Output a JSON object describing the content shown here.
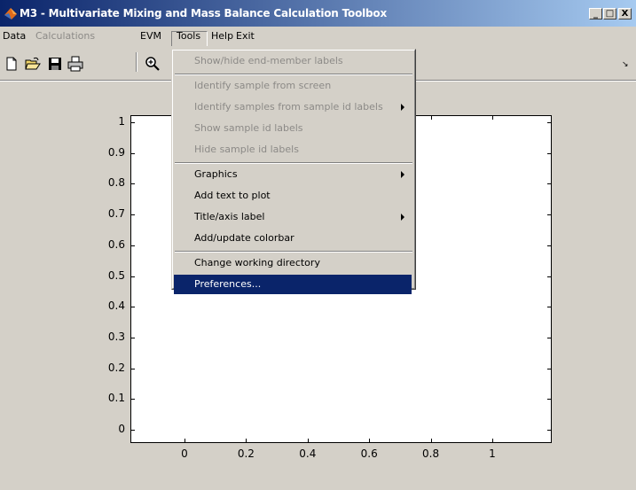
{
  "window": {
    "title": "M3 - Multivariate Mixing and Mass Balance Calculation Toolbox",
    "controls": {
      "minimize": "_",
      "maximize": "□",
      "close": "X"
    }
  },
  "menubar": {
    "items": [
      {
        "label": "Data",
        "enabled": true
      },
      {
        "label": "Calculations",
        "enabled": false
      },
      {
        "label": "EVM",
        "enabled": true
      },
      {
        "label": "Tools",
        "enabled": true,
        "open": true
      },
      {
        "label": "Help",
        "enabled": true
      },
      {
        "label": "Exit",
        "enabled": true
      }
    ],
    "dock_icon": "dock-arrow-icon"
  },
  "toolbar": {
    "buttons": [
      "new-file-icon",
      "open-folder-icon",
      "save-icon",
      "print-icon",
      "zoom-in-icon"
    ]
  },
  "tools_menu": {
    "items": [
      {
        "label": "Show/hide end-member labels",
        "enabled": false,
        "submenu": false
      },
      {
        "separator": true
      },
      {
        "label": "Identify sample from screen",
        "enabled": false,
        "submenu": false
      },
      {
        "label": "Identify samples from sample id labels",
        "enabled": false,
        "submenu": true
      },
      {
        "label": "Show sample id labels",
        "enabled": false,
        "submenu": false
      },
      {
        "label": "Hide sample id labels",
        "enabled": false,
        "submenu": false
      },
      {
        "separator": true
      },
      {
        "label": "Graphics",
        "enabled": true,
        "submenu": true
      },
      {
        "label": "Add text to plot",
        "enabled": true,
        "submenu": false
      },
      {
        "label": "Title/axis label",
        "enabled": true,
        "submenu": true
      },
      {
        "label": "Add/update colorbar",
        "enabled": true,
        "submenu": false
      },
      {
        "separator": true
      },
      {
        "label": "Change working directory",
        "enabled": true,
        "submenu": false
      },
      {
        "label": "Preferences...",
        "enabled": true,
        "submenu": false,
        "highlighted": true
      }
    ]
  },
  "plot": {
    "y_ticks": [
      "0",
      "0.1",
      "0.2",
      "0.3",
      "0.4",
      "0.5",
      "0.6",
      "0.7",
      "0.8",
      "0.9",
      "1"
    ],
    "x_ticks": [
      "0",
      "0.2",
      "0.4",
      "0.6",
      "0.8",
      "1"
    ]
  },
  "colors": {
    "title_gradient_start": "#0a246a",
    "title_gradient_end": "#a6caf0",
    "menu_highlight": "#0a246a",
    "disabled_text": "#8c8a87",
    "face": "#d4d0c8"
  }
}
